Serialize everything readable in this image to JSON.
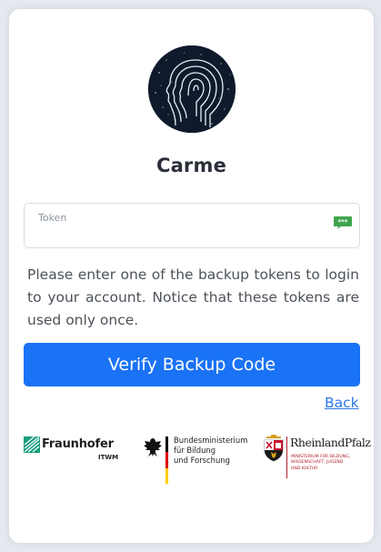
{
  "app": {
    "title": "Carme"
  },
  "token_field": {
    "label": "Token",
    "value": "",
    "icon": "password-manager-icon"
  },
  "instructions": "Please enter one of the backup tokens to login to your account. Notice that these tokens are used only once.",
  "actions": {
    "verify_label": "Verify Backup Code",
    "back_label": "Back"
  },
  "partners": {
    "fraunhofer_name": "Fraunhofer",
    "fraunhofer_unit": "ITWM",
    "bmbf_lines": [
      "Bundesministerium",
      "für Bildung",
      "und Forschung"
    ],
    "rlp_name": "RheinlandPfalz",
    "rlp_sub_lines": [
      "Ministerium für Bildung,",
      "Wissenschaft, Jugend",
      "und Kultur"
    ]
  },
  "colors": {
    "primary": "#1a72f5",
    "link": "#2c78e8",
    "page_background": "#e4e9ef",
    "logo_background": "#0f1a2c",
    "fraunhofer_green": "#179c7d",
    "rlp_red": "#b01e2a"
  }
}
